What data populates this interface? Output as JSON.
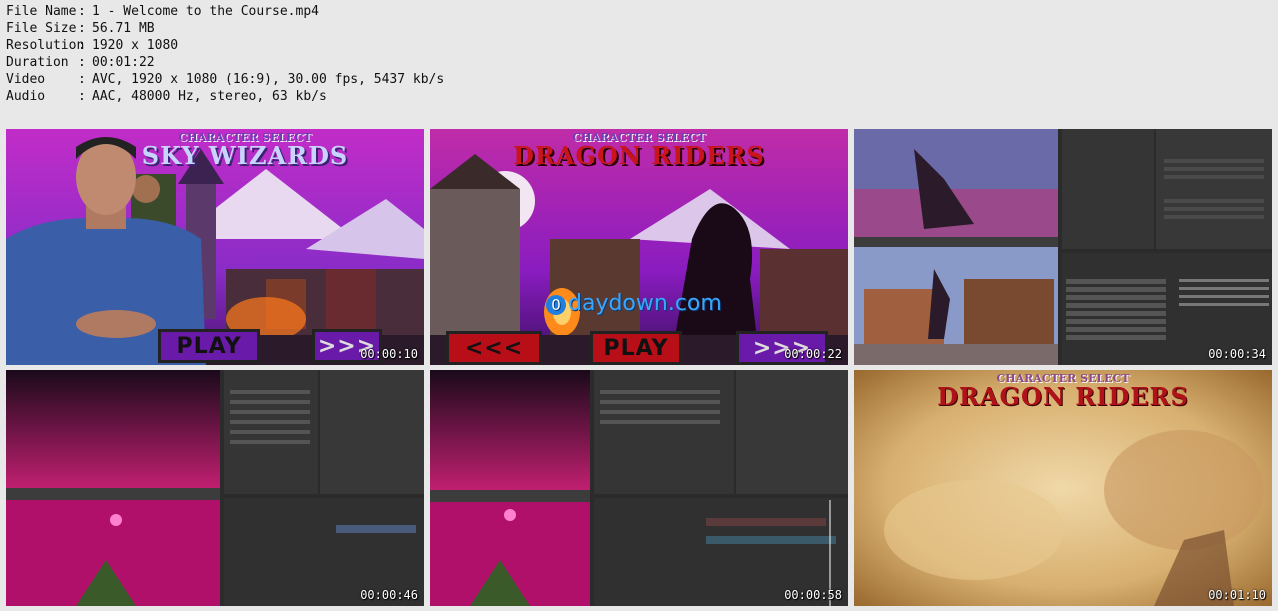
{
  "file_info": [
    {
      "key": "File Name",
      "value": "1 - Welcome to the Course.mp4"
    },
    {
      "key": "File Size",
      "value": "56.71 MB"
    },
    {
      "key": "Resolution",
      "value": "1920 x 1080"
    },
    {
      "key": "Duration",
      "value": "00:01:22"
    },
    {
      "key": "Video",
      "value": "AVC, 1920 x 1080 (16:9), 30.00 fps, 5437 kb/s"
    },
    {
      "key": "Audio",
      "value": "AAC, 48000 Hz, stereo, 63 kb/s"
    }
  ],
  "separator": ":",
  "thumbnails": [
    {
      "timestamp": "00:00:10",
      "subtitle": "CHARACTER SELECT",
      "title": "SKY WIZARDS",
      "button_play": "PLAY",
      "button_next": ">>>"
    },
    {
      "timestamp": "00:00:22",
      "subtitle": "CHARACTER SELECT",
      "title": "DRAGON RIDERS",
      "button_prev": "<<<",
      "button_play": "PLAY",
      "button_next": ">>>",
      "watermark_badge": "0",
      "watermark": "daydown.com"
    },
    {
      "timestamp": "00:00:34"
    },
    {
      "timestamp": "00:00:46"
    },
    {
      "timestamp": "00:00:58"
    },
    {
      "timestamp": "00:01:10",
      "subtitle": "CHARACTER SELECT",
      "title": "DRAGON RIDERS"
    }
  ],
  "colors": {
    "background": "#e8e8e8",
    "purple_sky": "#8a2cc8",
    "magenta": "#c01fa0",
    "editor_dark": "#2b2b2b",
    "title_red": "#b0121a",
    "smoke": "#d8b070"
  }
}
